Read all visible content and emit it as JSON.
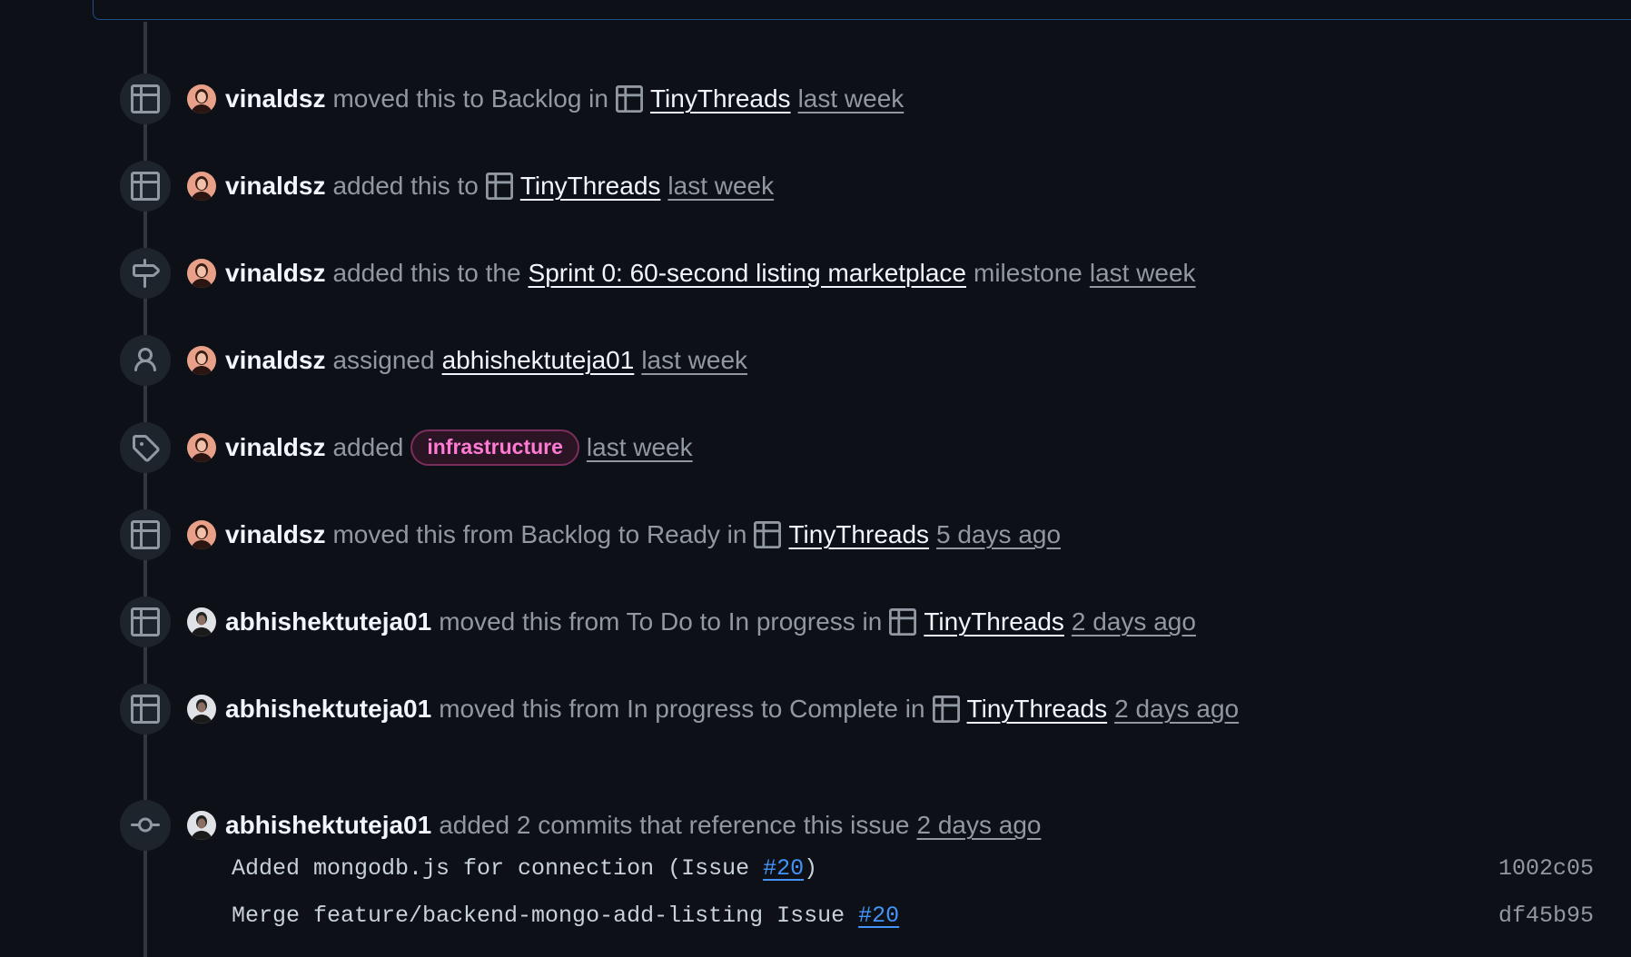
{
  "colors": {
    "background": "#0d1117",
    "text_primary": "#f0f6fc",
    "text_muted": "#9198a1",
    "link_blue": "#4493f8",
    "label_infrastructure": "#ff7bd4"
  },
  "events": [
    {
      "icon": "table-icon",
      "actor": "vinaldsz",
      "text1": "moved this to Backlog in",
      "target": "TinyThreads",
      "time": "last week"
    },
    {
      "icon": "table-icon",
      "actor": "vinaldsz",
      "text1": "added this to",
      "target": "TinyThreads",
      "time": "last week"
    },
    {
      "icon": "milestone-icon",
      "actor": "vinaldsz",
      "text1": "added this to the",
      "target": "Sprint 0: 60-second listing marketplace",
      "text2": "milestone",
      "time": "last week"
    },
    {
      "icon": "person-icon",
      "actor": "vinaldsz",
      "text1": "assigned",
      "target": "abhishektuteja01",
      "time": "last week"
    },
    {
      "icon": "tag-icon",
      "actor": "vinaldsz",
      "text1": "added",
      "label": "infrastructure",
      "time": "last week"
    },
    {
      "icon": "table-icon",
      "actor": "vinaldsz",
      "text1": "moved this from Backlog to Ready in",
      "target": "TinyThreads",
      "time": "5 days ago"
    },
    {
      "icon": "table-icon",
      "actor": "abhishektuteja01",
      "text1": "moved this from To Do to In progress in",
      "target": "TinyThreads",
      "time": "2 days ago"
    },
    {
      "icon": "table-icon",
      "actor": "abhishektuteja01",
      "text1": "moved this from In progress to Complete in",
      "target": "TinyThreads",
      "time": "2 days ago"
    },
    {
      "icon": "git-commit-icon",
      "actor": "abhishektuteja01",
      "text1": "added 2 commits that reference this issue",
      "time": "2 days ago"
    }
  ],
  "commits": [
    {
      "message": "Added mongodb.js for connection (Issue ",
      "ref": "#20",
      "message_end": ")",
      "sha": "1002c05"
    },
    {
      "message": "Merge feature/backend-mongo-add-listing Issue ",
      "ref": "#20",
      "message_end": "",
      "sha": "df45b95"
    }
  ]
}
